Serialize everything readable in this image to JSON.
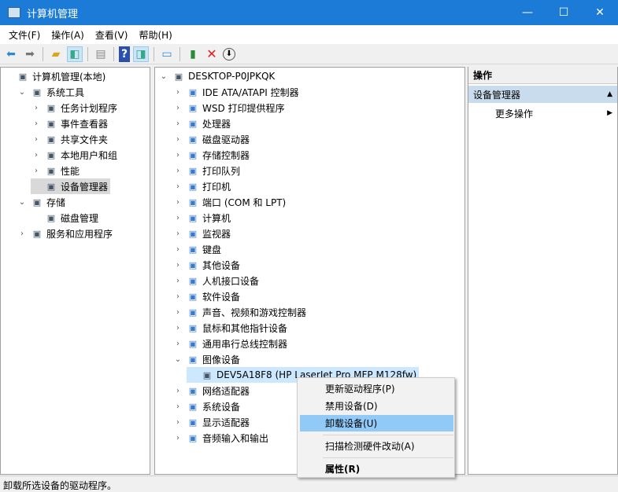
{
  "window": {
    "title": "计算机管理",
    "minimize": "—",
    "maximize": "☐",
    "close": "✕"
  },
  "menu": [
    "文件(F)",
    "操作(A)",
    "查看(V)",
    "帮助(H)"
  ],
  "left_tree": [
    {
      "label": "计算机管理(本地)",
      "level": 0,
      "arrow": ""
    },
    {
      "label": "系统工具",
      "level": 1,
      "arrow": "⌄"
    },
    {
      "label": "任务计划程序",
      "level": 2,
      "arrow": "›"
    },
    {
      "label": "事件查看器",
      "level": 2,
      "arrow": "›"
    },
    {
      "label": "共享文件夹",
      "level": 2,
      "arrow": "›"
    },
    {
      "label": "本地用户和组",
      "level": 2,
      "arrow": "›"
    },
    {
      "label": "性能",
      "level": 2,
      "arrow": "›"
    },
    {
      "label": "设备管理器",
      "level": 2,
      "arrow": ""
    },
    {
      "label": "存储",
      "level": 1,
      "arrow": "⌄"
    },
    {
      "label": "磁盘管理",
      "level": 2,
      "arrow": ""
    },
    {
      "label": "服务和应用程序",
      "level": 1,
      "arrow": "›"
    }
  ],
  "device_tree": {
    "root": "DESKTOP-P0JPKQK",
    "items": [
      "IDE ATA/ATAPI 控制器",
      "WSD 打印提供程序",
      "处理器",
      "磁盘驱动器",
      "存储控制器",
      "打印队列",
      "打印机",
      "端口 (COM 和 LPT)",
      "计算机",
      "监视器",
      "键盘",
      "其他设备",
      "人机接口设备",
      "软件设备",
      "声音、视频和游戏控制器",
      "鼠标和其他指针设备",
      "通用串行总线控制器",
      "图像设备"
    ],
    "child": "DEV5A18F8 (HP LaserJet Pro MFP M128fw)",
    "items_after": [
      "网络适配器",
      "系统设备",
      "显示适配器",
      "音频输入和输出"
    ]
  },
  "actions": {
    "header": "操作",
    "section": "设备管理器",
    "more": "更多操作"
  },
  "context_menu": {
    "update": "更新驱动程序(P)",
    "disable": "禁用设备(D)",
    "uninstall": "卸载设备(U)",
    "scan": "扫描检测硬件改动(A)",
    "properties": "属性(R)"
  },
  "status": "卸载所选设备的驱动程序。"
}
